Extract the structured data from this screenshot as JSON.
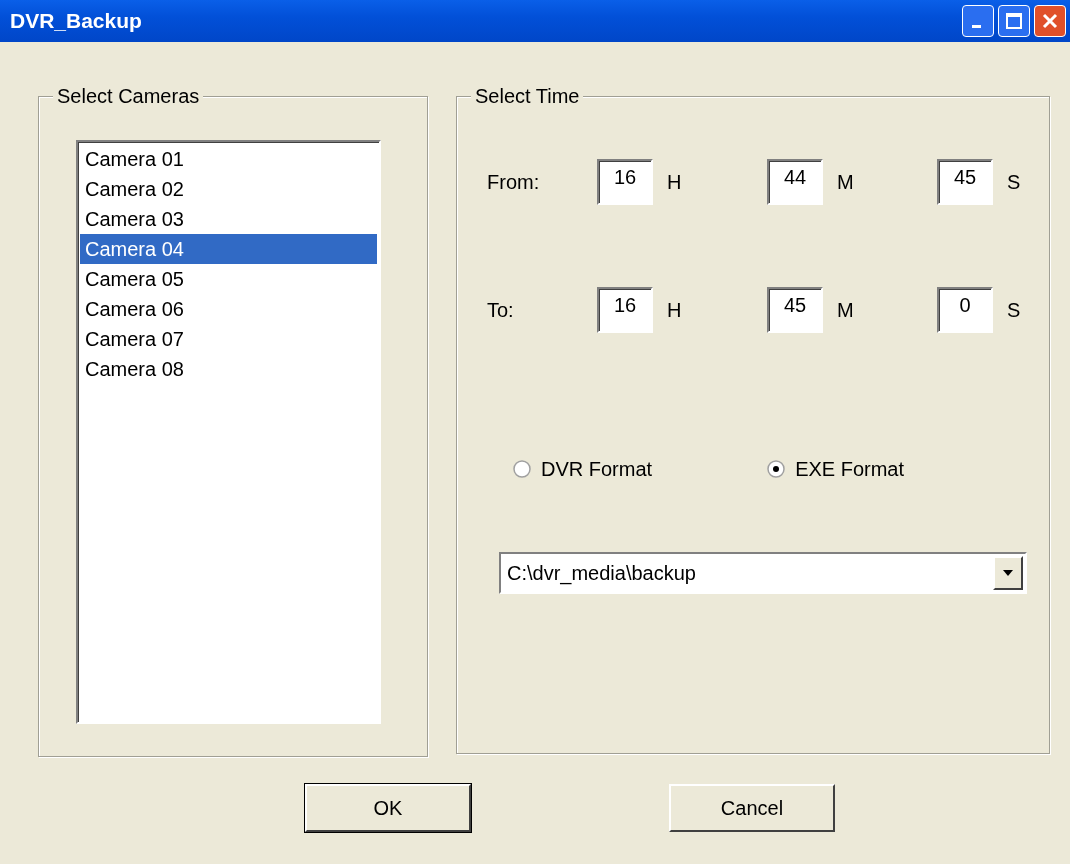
{
  "window": {
    "title": "DVR_Backup"
  },
  "cameras": {
    "legend": "Select Cameras",
    "items": [
      {
        "label": "Camera 01",
        "selected": false
      },
      {
        "label": "Camera 02",
        "selected": false
      },
      {
        "label": "Camera 03",
        "selected": false
      },
      {
        "label": "Camera 04",
        "selected": true
      },
      {
        "label": "Camera 05",
        "selected": false
      },
      {
        "label": "Camera 06",
        "selected": false
      },
      {
        "label": "Camera 07",
        "selected": false
      },
      {
        "label": "Camera 08",
        "selected": false
      }
    ]
  },
  "time": {
    "legend": "Select Time",
    "rows": [
      {
        "label": "From:",
        "fields": [
          {
            "value": "16",
            "unit": "H"
          },
          {
            "value": "44",
            "unit": "M"
          },
          {
            "value": "45",
            "unit": "S"
          }
        ]
      },
      {
        "label": "To:",
        "fields": [
          {
            "value": "16",
            "unit": "H"
          },
          {
            "value": "45",
            "unit": "M"
          },
          {
            "value": "0",
            "unit": "S"
          }
        ]
      }
    ]
  },
  "formats": [
    {
      "label": "DVR Format",
      "selected": false
    },
    {
      "label": "EXE Format",
      "selected": true
    }
  ],
  "path": {
    "value": "C:\\dvr_media\\backup"
  },
  "buttons": [
    {
      "label": "OK",
      "default": true
    },
    {
      "label": "Cancel",
      "default": false
    }
  ]
}
